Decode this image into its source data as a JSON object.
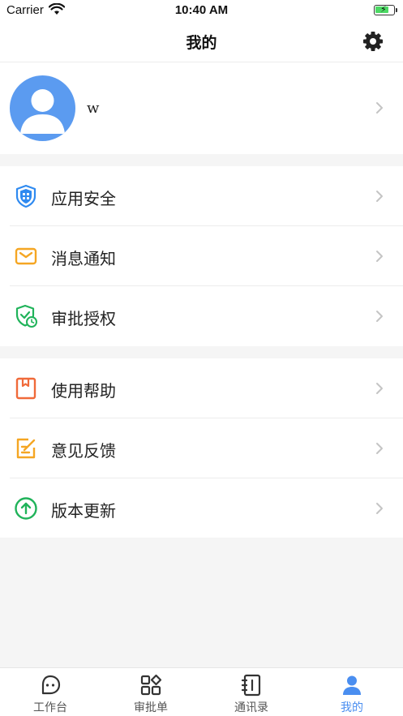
{
  "status_bar": {
    "carrier": "Carrier",
    "time": "10:40 AM"
  },
  "nav": {
    "title": "我的",
    "settings_icon": "gear-icon"
  },
  "profile": {
    "name": "w",
    "avatar_color": "#5b9bf0"
  },
  "menu_group_1": [
    {
      "label": "应用安全",
      "icon": "shield-icon",
      "color": "#2f8af0"
    },
    {
      "label": "消息通知",
      "icon": "mail-icon",
      "color": "#f5a623"
    },
    {
      "label": "审批授权",
      "icon": "approval-shield-icon",
      "color": "#20b35a"
    }
  ],
  "menu_group_2": [
    {
      "label": "使用帮助",
      "icon": "help-book-icon",
      "color": "#f06a3a"
    },
    {
      "label": "意见反馈",
      "icon": "feedback-icon",
      "color": "#f5a623"
    },
    {
      "label": "版本更新",
      "icon": "upgrade-icon",
      "color": "#20b35a"
    }
  ],
  "tabs": [
    {
      "label": "工作台",
      "icon": "chat-bubble-icon",
      "active": false
    },
    {
      "label": "审批单",
      "icon": "grid-icon",
      "active": false
    },
    {
      "label": "通讯录",
      "icon": "contacts-book-icon",
      "active": false
    },
    {
      "label": "我的",
      "icon": "person-icon",
      "active": true
    }
  ],
  "colors": {
    "accent": "#4a8ef0",
    "background": "#f5f5f5"
  }
}
